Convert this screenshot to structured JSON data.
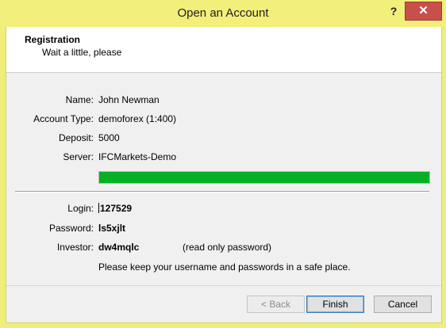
{
  "window": {
    "title": "Open an Account",
    "help_label": "?",
    "close_label": "✕"
  },
  "header": {
    "title": "Registration",
    "subtitle": "Wait a little, please"
  },
  "account": {
    "name_label": "Name:",
    "name": "John Newman",
    "type_label": "Account Type:",
    "type": "demoforex (1:400)",
    "deposit_label": "Deposit:",
    "deposit": "5000",
    "server_label": "Server:",
    "server": "IFCMarkets-Demo",
    "progress_fraction": 1.0,
    "progress_color": "#06b025"
  },
  "credentials": {
    "login_label": "Login:",
    "login": "127529",
    "password_label": "Password:",
    "password": "ls5xjlt",
    "investor_label": "Investor:",
    "investor": "dw4mqlc",
    "investor_note": "(read only password)",
    "safety_note": "Please keep your username and passwords in a safe place."
  },
  "buttons": {
    "back": "< Back",
    "finish": "Finish",
    "cancel": "Cancel"
  }
}
